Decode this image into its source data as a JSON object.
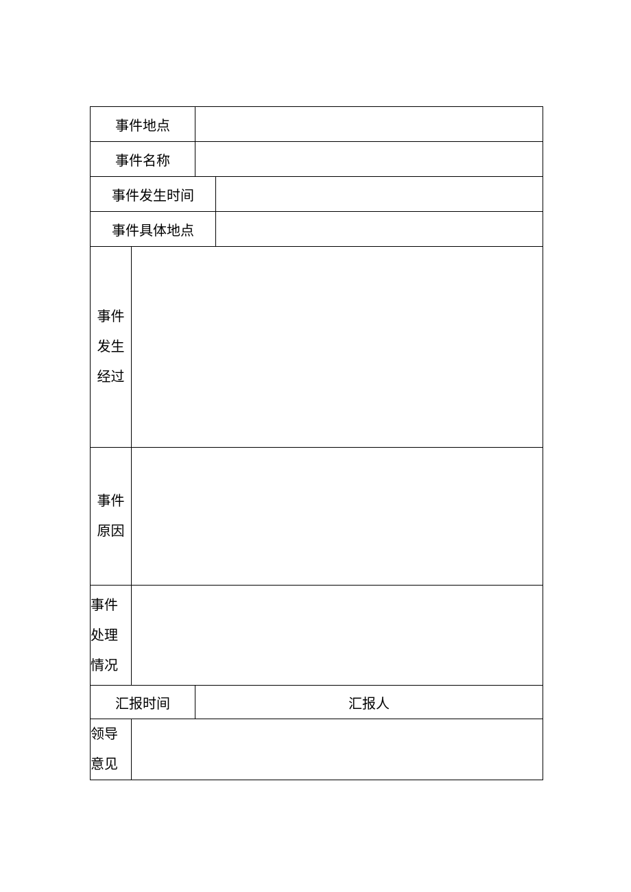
{
  "labels": {
    "event_location": "事件地点",
    "event_name": "事件名称",
    "event_time": "事件发生时间",
    "event_specific_location": "事件具体地点",
    "event_course_1": "事件",
    "event_course_2": "发生",
    "event_course_3": "经过",
    "event_reason_1": "事件",
    "event_reason_2": "原因",
    "event_handling_1": "事件",
    "event_handling_2": "处理",
    "event_handling_3": "情况",
    "report_time": "汇报时间",
    "reporter": "汇报人",
    "leader_opinion_1": "领导",
    "leader_opinion_2": "意见"
  },
  "values": {
    "event_location": "",
    "event_name": "",
    "event_time": "",
    "event_specific_location": "",
    "event_course": "",
    "event_reason": "",
    "event_handling": "",
    "report_time": "",
    "reporter": "",
    "leader_opinion": ""
  }
}
